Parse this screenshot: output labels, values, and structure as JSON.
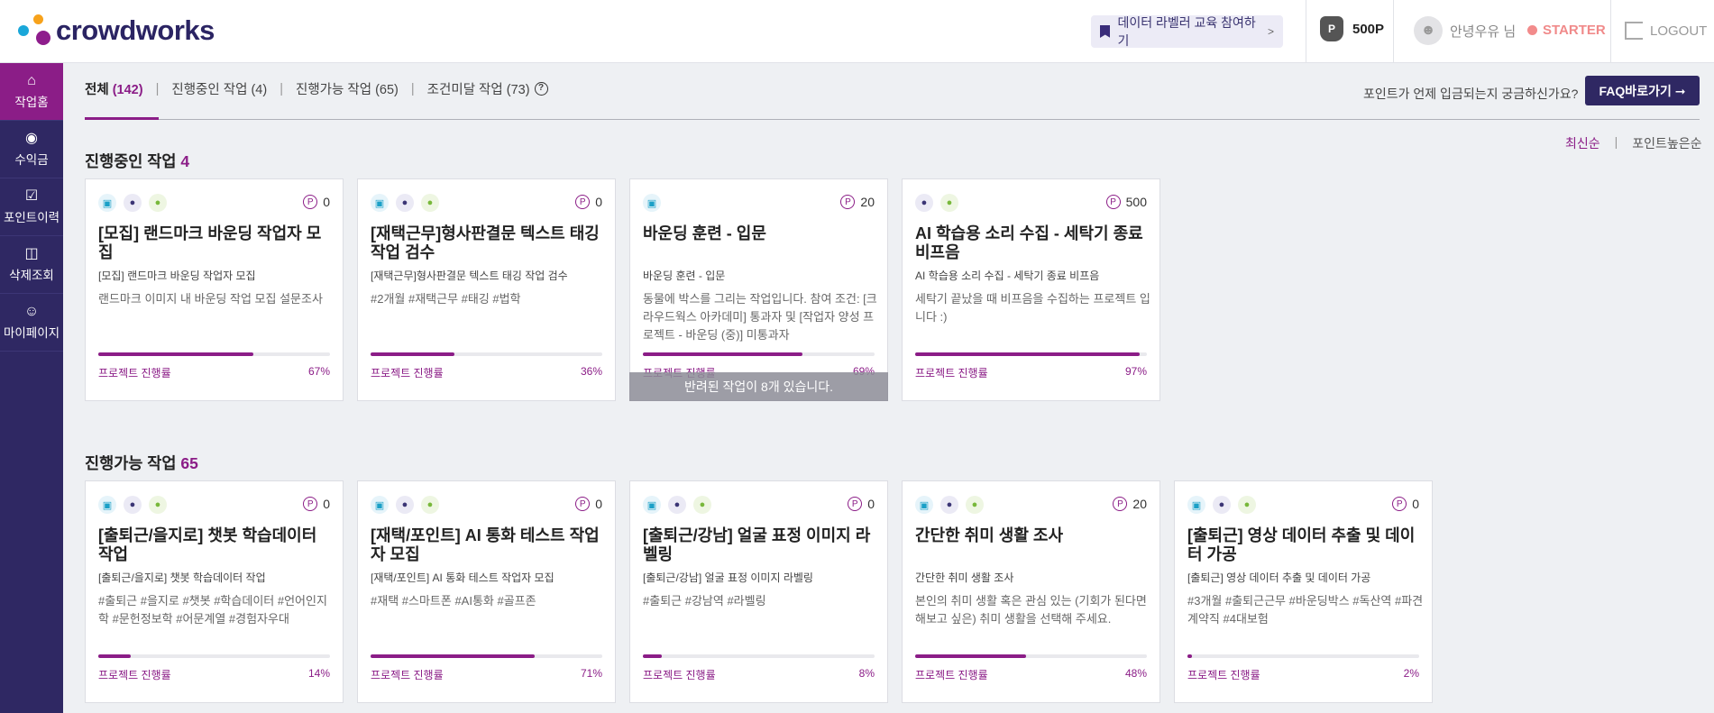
{
  "header": {
    "logo_text": "crowdworks",
    "edu_button": "데이터 라벨러 교육 참여하기",
    "points": "500P",
    "user_greeting": "안녕우유 님",
    "grade": "STARTER",
    "logout": "LOGOUT"
  },
  "sidebar": {
    "items": [
      {
        "label": "작업홈",
        "icon": "home-icon"
      },
      {
        "label": "수익금",
        "icon": "money-bag-icon"
      },
      {
        "label": "포인트이력",
        "icon": "history-icon"
      },
      {
        "label": "삭제조회",
        "icon": "trash-icon"
      },
      {
        "label": "마이페이지",
        "icon": "user-icon"
      }
    ]
  },
  "tabs": [
    {
      "label": "전체",
      "count": "(142)"
    },
    {
      "label": "진행중인 작업",
      "count": "(4)"
    },
    {
      "label": "진행가능 작업",
      "count": "(65)"
    },
    {
      "label": "조건미달 작업",
      "count": "(73)"
    }
  ],
  "faq": {
    "question": "포인트가 언제 입금되는지 궁금하신가요?",
    "button": "FAQ바로가기 ➞"
  },
  "sort": {
    "latest": "최신순",
    "points_high": "포인트높은순"
  },
  "progress_label": "프로젝트 진행률",
  "ongoing": {
    "title": "진행중인 작업",
    "count": "4",
    "overlay": "반려된 작업이 8개 있습니다.",
    "cards": [
      {
        "title": "[모집] 랜드마크 바운딩 작업자 모집",
        "sub": "[모집] 랜드마크 바운딩 작업자 모집",
        "desc": "랜드마크 이미지 내 바운딩 작업 모집 설문조사",
        "points": "0",
        "progress": 67,
        "progress_text": "67%",
        "platforms": [
          "pc",
          "ios",
          "android"
        ]
      },
      {
        "title": "[재택근무]형사판결문 텍스트 태깅 작업 검수",
        "sub": "[재택근무]형사판결문 텍스트 태깅 작업 검수",
        "desc": "#2개월 #재택근무 #태깅 #법학",
        "points": "0",
        "progress": 36,
        "progress_text": "36%",
        "platforms": [
          "pc",
          "ios",
          "android"
        ]
      },
      {
        "title": "바운딩 훈련 - 입문",
        "sub": "바운딩 훈련 - 입문",
        "desc": "동물에 박스를 그리는 작업입니다. 참여 조건: [크라우드웍스 아카데미] 통과자 및 [작업자 양성 프로젝트 - 바운딩 (중)] 미통과자",
        "points": "20",
        "progress": 69,
        "progress_text": "69%",
        "platforms": [
          "pc"
        ]
      },
      {
        "title": "AI 학습용 소리 수집 - 세탁기 종료 비프음",
        "sub": "AI 학습용 소리 수집 - 세탁기 종료 비프음",
        "desc": "세탁기 끝났을 때 비프음을 수집하는 프로젝트 입니다 :)",
        "points": "500",
        "progress": 97,
        "progress_text": "97%",
        "platforms": [
          "ios",
          "android"
        ]
      }
    ]
  },
  "available": {
    "title": "진행가능 작업",
    "count": "65",
    "cards": [
      {
        "title": "[출퇴근/을지로] 챗봇 학습데이터 작업",
        "sub": "[출퇴근/을지로] 챗봇 학습데이터 작업",
        "desc": "#출퇴근 #을지로 #챗봇 #학습데이터 #언어인지학 #문헌정보학 #어문계열 #경험자우대",
        "points": "0",
        "progress": 14,
        "progress_text": "14%",
        "platforms": [
          "pc",
          "ios",
          "android"
        ]
      },
      {
        "title": "[재택/포인트] AI 통화 테스트 작업자 모집",
        "sub": "[재택/포인트] AI 통화 테스트 작업자 모집",
        "desc": "#재택 #스마트폰 #AI통화 #골프존",
        "points": "0",
        "progress": 71,
        "progress_text": "71%",
        "platforms": [
          "pc",
          "ios",
          "android"
        ]
      },
      {
        "title": "[출퇴근/강남] 얼굴 표정 이미지 라벨링",
        "sub": "[출퇴근/강남] 얼굴 표정 이미지 라벨링",
        "desc": "#출퇴근 #강남역 #라벨링",
        "points": "0",
        "progress": 8,
        "progress_text": "8%",
        "platforms": [
          "pc",
          "ios",
          "android"
        ]
      },
      {
        "title": "간단한 취미 생활 조사",
        "sub": "간단한 취미 생활 조사",
        "desc": "본인의 취미 생활 혹은 관심 있는 (기회가 된다면 해보고 싶은) 취미 생활을 선택해 주세요.",
        "points": "20",
        "progress": 48,
        "progress_text": "48%",
        "platforms": [
          "pc",
          "ios",
          "android"
        ]
      },
      {
        "title": "[출퇴근] 영상 데이터 추출 및 데이터 가공",
        "sub": "[출퇴근] 영상 데이터 추출 및 데이터 가공",
        "desc": "#3개월 #출퇴근근무 #바운딩박스 #독산역 #파견계약직 #4대보험",
        "points": "0",
        "progress": 2,
        "progress_text": "2%",
        "platforms": [
          "pc",
          "ios",
          "android"
        ]
      }
    ]
  }
}
